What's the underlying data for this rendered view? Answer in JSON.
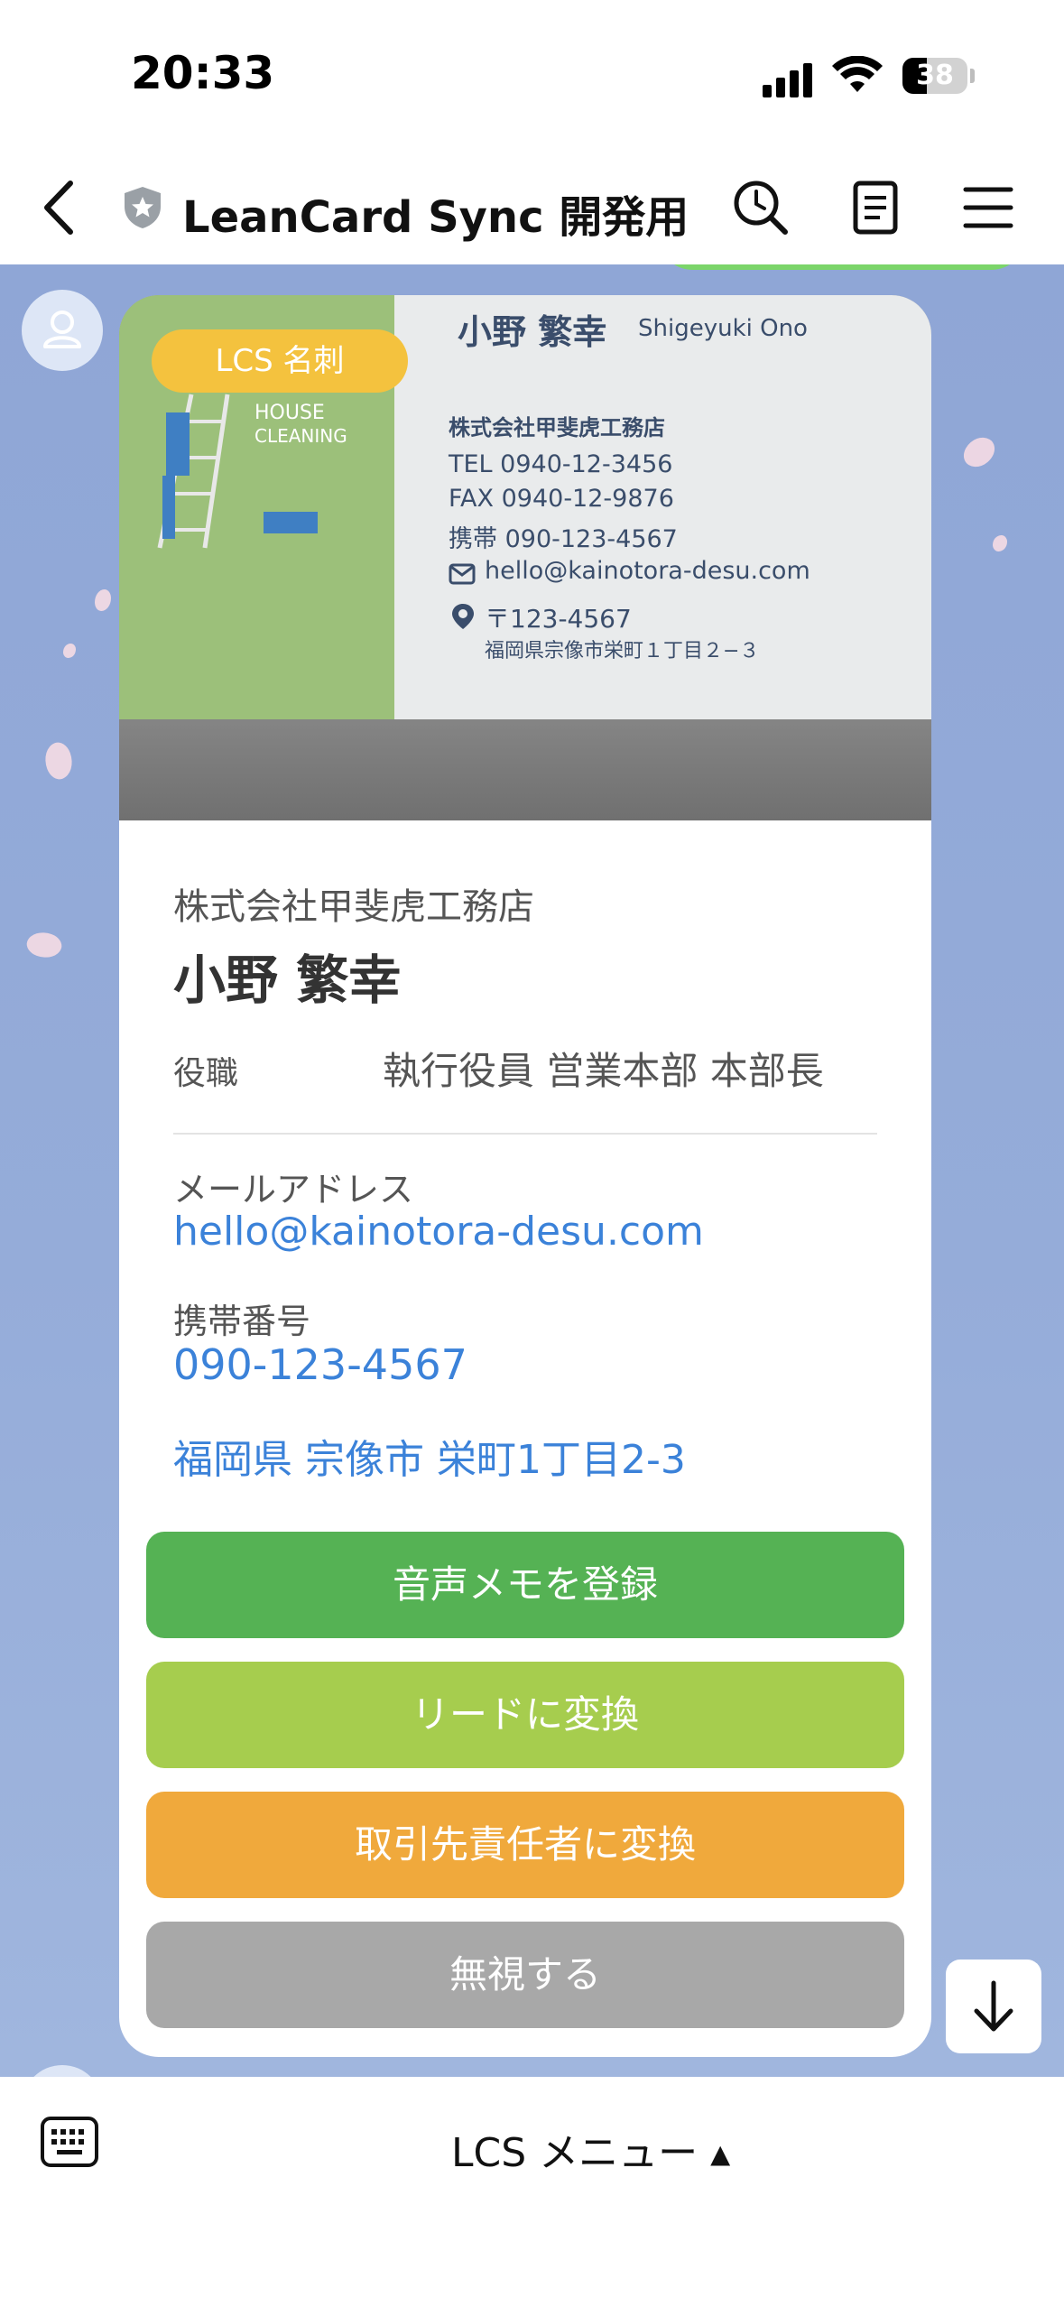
{
  "status_bar": {
    "time": "20:33",
    "battery": "38",
    "battery_level_percent": 38
  },
  "header": {
    "title": "LeanCard Sync 開発用",
    "icons": [
      "back-arrow-icon",
      "shield-icon",
      "search-clock-icon",
      "notes-icon",
      "menu-icon"
    ]
  },
  "card": {
    "badge": "LCS 名刺",
    "photo_text": {
      "name_jp": "小野 繁幸",
      "name_en": "Shigeyuki Ono",
      "house": "HOUSE",
      "cleaning": "CLEANING",
      "company": "株式会社甲斐虎工務店",
      "tel": "TEL 0940-12-3456",
      "fax": "FAX 0940-12-9876",
      "mobile": "携帯 090-123-4567",
      "email": "hello@kainotora-desu.com",
      "postal": "〒123-4567",
      "address": "福岡県宗像市栄町１丁目２−３"
    },
    "company": "株式会社甲斐虎工務店",
    "name": "小野 繁幸",
    "role_label": "役職",
    "role_value": "執行役員 営業本部 本部長",
    "email_label": "メールアドレス",
    "email_value": "hello@kainotora-desu.com",
    "mobile_label": "携帯番号",
    "mobile_value": "090-123-4567",
    "address_value": "福岡県 宗像市 栄町1丁目2-3",
    "buttons": {
      "voice_memo": "音声メモを登録",
      "to_lead": "リードに変換",
      "to_contact": "取引先責任者に変換",
      "ignore": "無視する"
    }
  },
  "bottom": {
    "menu_label": "LCS メニュー ▴"
  },
  "colors": {
    "chat_bg": "#95acd9",
    "btn_voice": "#55b254",
    "btn_lead": "#a6cd4e",
    "btn_contact": "#f0a93c",
    "btn_ignore": "#a8a8a8",
    "link": "#3b82d9",
    "badge": "#f4c23e"
  }
}
